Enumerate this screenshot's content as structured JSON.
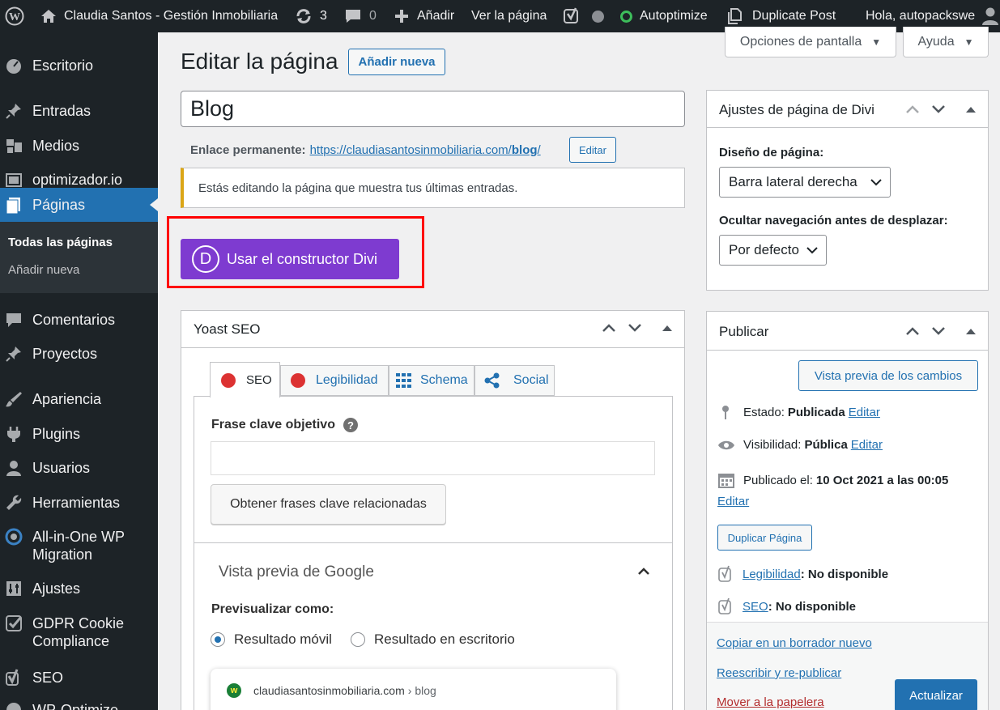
{
  "adminbar": {
    "site_name": "Claudia Santos - Gestión Inmobiliaria",
    "updates_count": "3",
    "comments_count": "0",
    "add_new": "Añadir",
    "view_page": "Ver la página",
    "autoptimize": "Autoptimize",
    "duplicate_post": "Duplicate Post",
    "greeting": "Hola, autopackswe"
  },
  "sidebar": {
    "items": [
      {
        "label": "Escritorio",
        "icon": "dashboard-icon"
      },
      {
        "label": "Entradas",
        "icon": "pin-icon"
      },
      {
        "label": "Medios",
        "icon": "media-icon"
      },
      {
        "label": "optimizador.io",
        "icon": "gallery-icon"
      },
      {
        "label": "Páginas",
        "icon": "page-icon"
      },
      {
        "label": "Comentarios",
        "icon": "comment-icon"
      },
      {
        "label": "Proyectos",
        "icon": "pin-icon"
      },
      {
        "label": "Apariencia",
        "icon": "brush-icon"
      },
      {
        "label": "Plugins",
        "icon": "plugin-icon"
      },
      {
        "label": "Usuarios",
        "icon": "user-icon"
      },
      {
        "label": "Herramientas",
        "icon": "wrench-icon"
      },
      {
        "label": "All-in-One WP Migration",
        "icon": "migration-icon"
      },
      {
        "label": "Ajustes",
        "icon": "settings-icon"
      },
      {
        "label": "GDPR Cookie Compliance",
        "icon": "check-icon"
      },
      {
        "label": "SEO",
        "icon": "yoast-icon"
      },
      {
        "label": "WP-Optimize",
        "icon": "optimize-icon"
      }
    ],
    "submenu": [
      "Todas las páginas",
      "Añadir nueva"
    ]
  },
  "screen_options": "Opciones de pantalla",
  "help": "Ayuda",
  "header": {
    "title": "Editar la página",
    "add_new": "Añadir nueva"
  },
  "post": {
    "title": "Blog",
    "permalink_label": "Enlace permanente:",
    "permalink_base": "https://claudiasantosinmobiliaria.com/",
    "permalink_slug": "blog",
    "permalink_end": "/",
    "edit_button": "Editar",
    "notice": "Estás editando la página que muestra tus últimas entradas.",
    "divi_button": "Usar el constructor Divi",
    "divi_letter": "D"
  },
  "yoast": {
    "title": "Yoast SEO",
    "tabs": [
      "SEO",
      "Legibilidad",
      "Schema",
      "Social"
    ],
    "keyphrase_label": "Frase clave objetivo",
    "help_glyph": "?",
    "related_button": "Obtener frases clave relacionadas",
    "google_preview": "Vista previa de Google",
    "preview_as": "Previsualizar como:",
    "mobile": "Resultado móvil",
    "desktop": "Resultado en escritorio",
    "snippet_domain": "claudiasantosinmobiliaria.com",
    "snippet_path": "› blog",
    "snippet_favicon": "w"
  },
  "divi_settings": {
    "title": "Ajustes de página de Divi",
    "layout_label": "Diseño de página:",
    "layout_value": "Barra lateral derecha",
    "nav_label": "Ocultar navegación antes de desplazar:",
    "nav_value": "Por defecto"
  },
  "publish": {
    "title": "Publicar",
    "preview_changes": "Vista previa de los cambios",
    "status_label": "Estado:",
    "status_value": "Publicada",
    "visibility_label": "Visibilidad:",
    "visibility_value": "Pública",
    "published_label": "Publicado el:",
    "published_value": "10 Oct 2021 a las 00:05",
    "edit": "Editar",
    "duplicate": "Duplicar Página",
    "readability_link": "Legibilidad",
    "readability_value": ": No disponible",
    "seo_link": "SEO",
    "seo_value": ": No disponible",
    "copy_draft": "Copiar en un borrador nuevo",
    "rewrite": "Reescribir y re-publicar",
    "trash": "Mover a la papelera",
    "update": "Actualizar"
  },
  "colors": {
    "admin_bar": "#1d2327",
    "accent": "#2271b1",
    "divi_purple": "#7e3bd0",
    "highlight_red": "#ff0000",
    "trash_red": "#b32d2e",
    "notice_yellow": "#dba617"
  }
}
